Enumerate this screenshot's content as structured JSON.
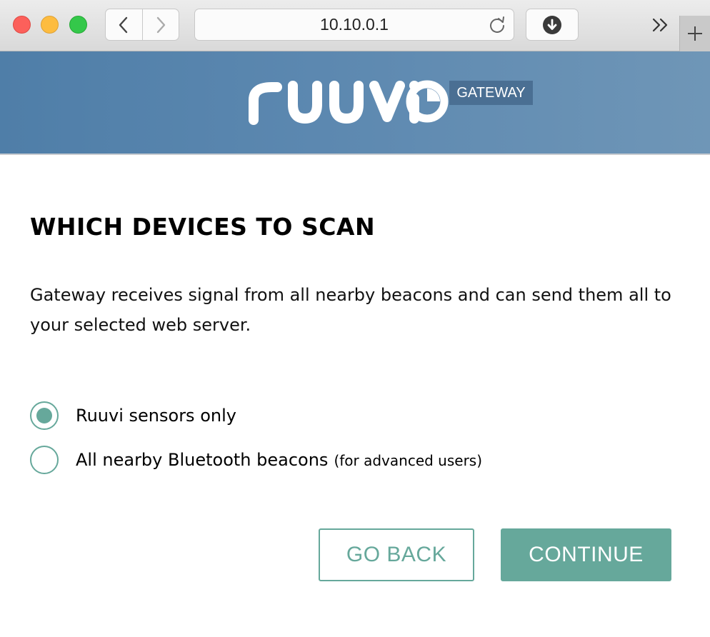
{
  "browser": {
    "url": "10.10.0.1",
    "icons": {
      "back": "chevron-left-icon",
      "forward": "chevron-right-icon",
      "reload": "reload-icon",
      "download": "download-icon",
      "more": "double-chevron-right-icon",
      "new_tab": "plus-icon"
    }
  },
  "header": {
    "logo_text": "ruuvi",
    "badge": "GATEWAY",
    "colors": {
      "banner": "#5c88b0",
      "badge": "#4a6f93"
    }
  },
  "page": {
    "title": "WHICH DEVICES TO SCAN",
    "description": "Gateway receives signal from all nearby beacons and can send them all to your selected web server."
  },
  "options": [
    {
      "label": "Ruuvi sensors only",
      "hint": "",
      "selected": true
    },
    {
      "label": "All nearby Bluetooth beacons",
      "hint": "(for advanced users)",
      "selected": false
    }
  ],
  "buttons": {
    "back_label": "GO BACK",
    "continue_label": "CONTINUE"
  },
  "colors": {
    "accent": "#66a89b"
  }
}
